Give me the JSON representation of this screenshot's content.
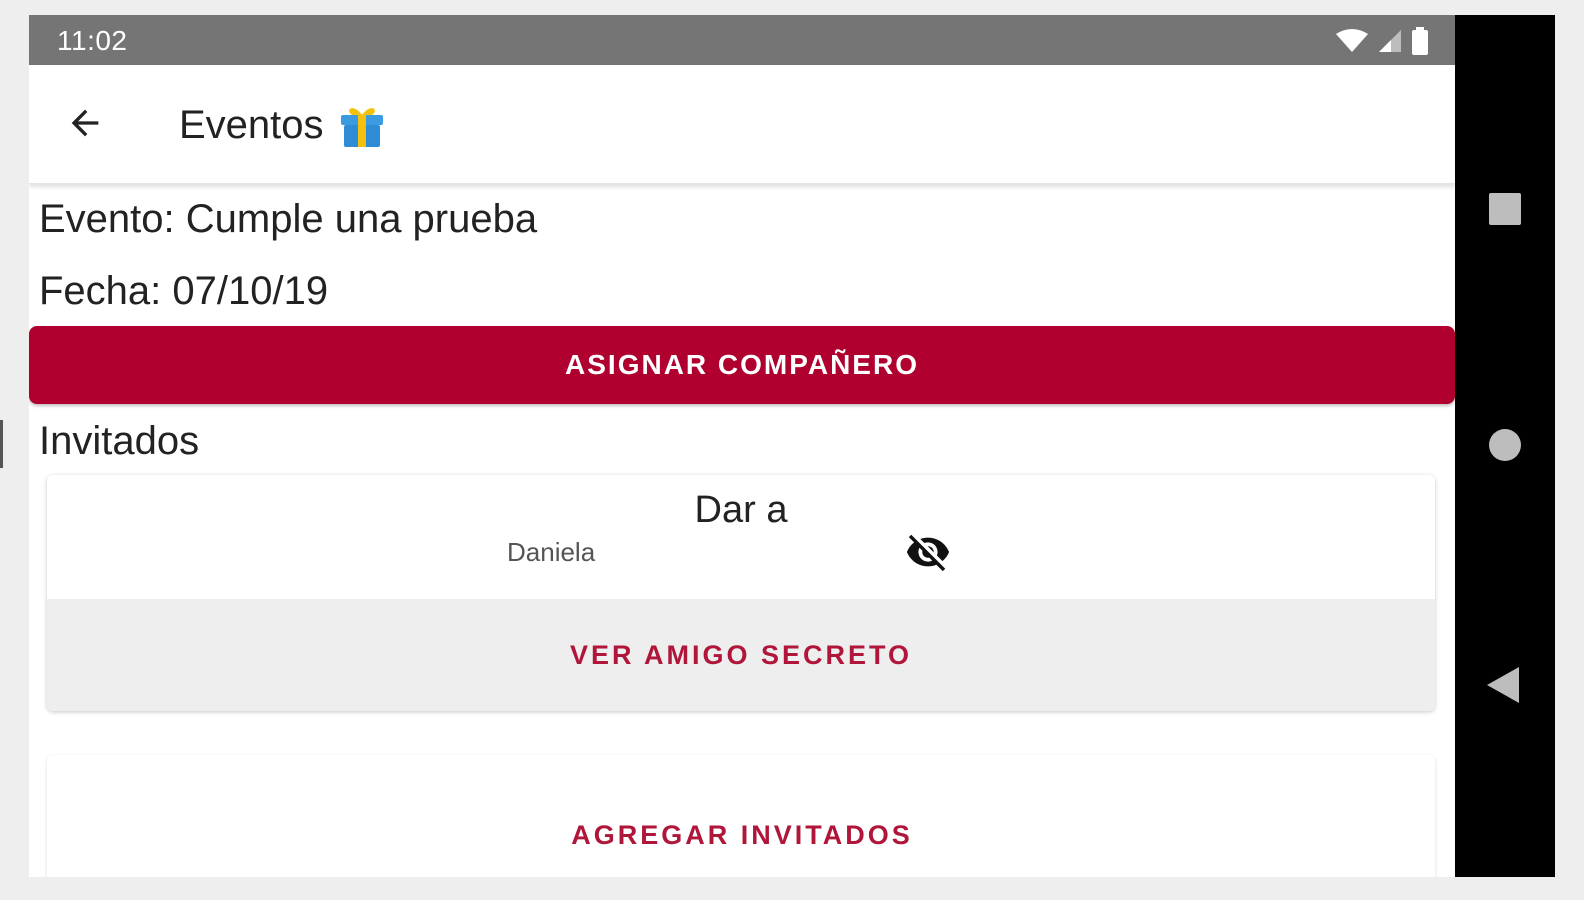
{
  "status_bar": {
    "time": "11:02",
    "icons": [
      "wifi-icon",
      "signal-icon",
      "battery-icon"
    ]
  },
  "toolbar": {
    "back_icon": "arrow-back-icon",
    "title": "Eventos",
    "title_emoji": "🎁"
  },
  "event": {
    "name_line": "Evento: Cumple una prueba",
    "date_line": "Fecha: 07/10/19"
  },
  "assign_button": "ASIGNAR COMPAÑERO",
  "guests": {
    "heading": "Invitados",
    "items": [
      {
        "title": "Dar a",
        "name": "Daniela",
        "visibility_icon": "eye-off-icon",
        "action": "VER AMIGO SECRETO"
      }
    ]
  },
  "add_guests_button": "AGREGAR INVITADOS",
  "navigation_bar": {
    "icons": [
      "recents-icon",
      "home-icon",
      "back-icon"
    ]
  },
  "colors": {
    "accent": "#b00030",
    "accent_text": "#b0163a",
    "status_bar": "#757575",
    "nav_bar": "#000000"
  }
}
